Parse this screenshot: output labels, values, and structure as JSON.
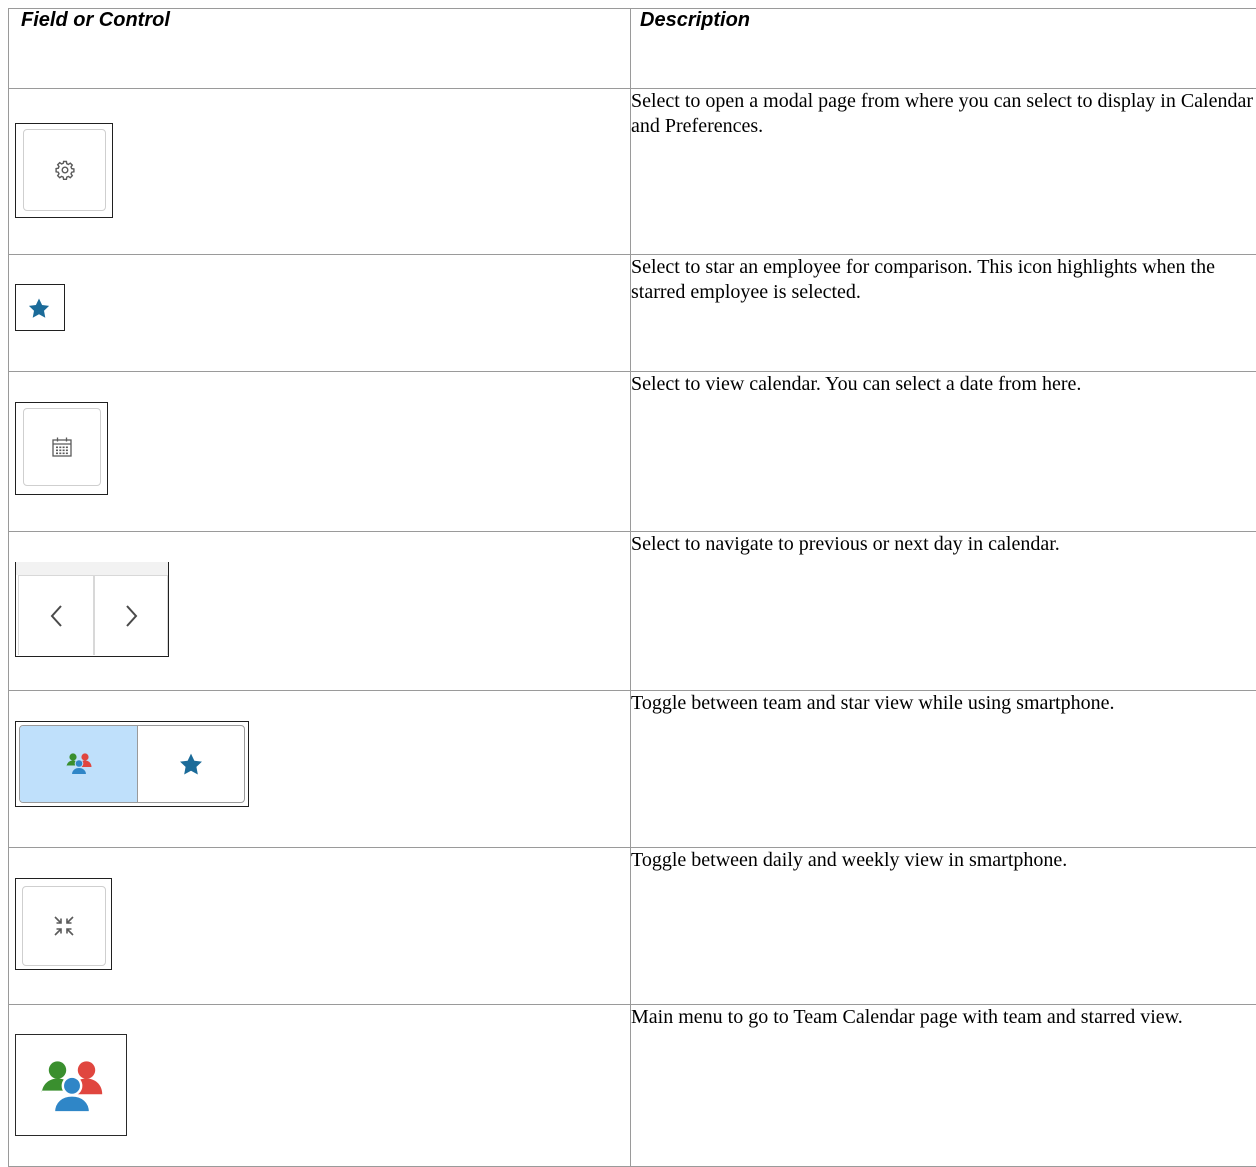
{
  "header": {
    "col1": "Field or Control",
    "col2": "Description"
  },
  "rows": [
    {
      "icon": "gear-icon",
      "description": "Select to open a modal page from where you can select to display in Calendar and Preferences."
    },
    {
      "icon": "star-icon",
      "description": "Select to star an employee for comparison. This icon highlights when the starred employee is selected."
    },
    {
      "icon": "calendar-icon",
      "description": "Select to view calendar. You can select a date from here."
    },
    {
      "icon": "prev-next-arrows-icon",
      "description": "Select to navigate to previous or next day in calendar."
    },
    {
      "icon": "team-star-toggle-icon",
      "description": "Toggle between team and star view while using smartphone."
    },
    {
      "icon": "collapse-view-icon",
      "description": "Toggle between daily and weekly view in smartphone."
    },
    {
      "icon": "team-icon",
      "description": "Main menu to go to Team Calendar page with team and starred view."
    }
  ],
  "colors": {
    "star_blue": "#1b6b99",
    "team_green": "#3a8f2e",
    "team_red": "#e0463f",
    "team_blue": "#2f86c7",
    "toggle_selected_bg": "#bfe0fb",
    "icon_grey": "#5a5a5a"
  }
}
